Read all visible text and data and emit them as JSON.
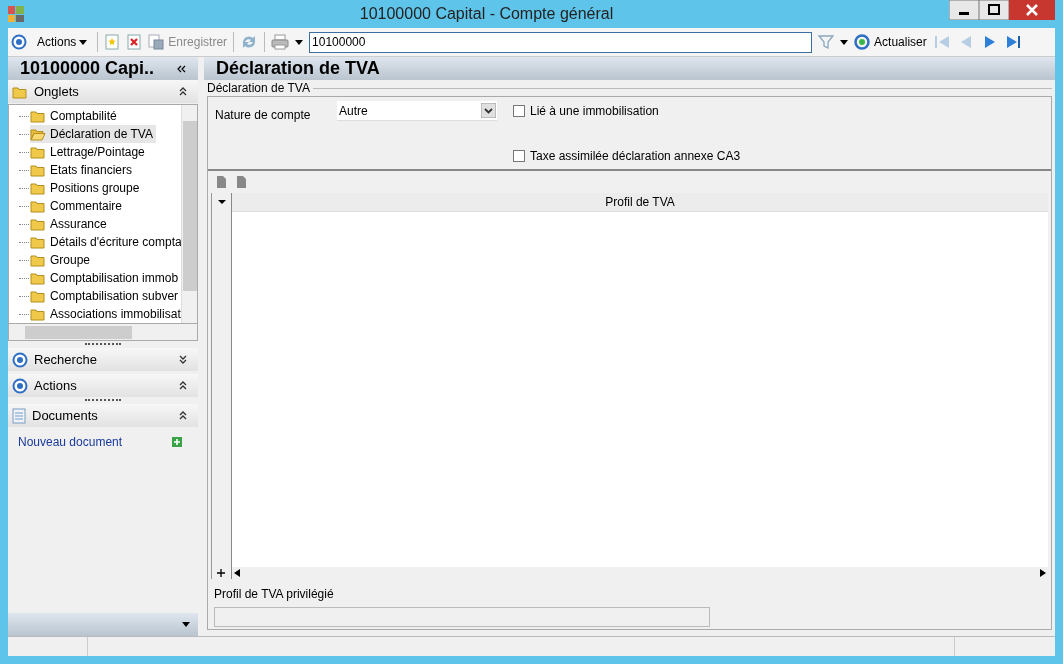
{
  "window": {
    "title": "10100000 Capital -  Compte général"
  },
  "toolbar": {
    "actions_label": "Actions",
    "save_label": "Enregistrer",
    "search_value": "10100000",
    "refresh_label": "Actualiser"
  },
  "left_panel": {
    "title": "10100000 Capi..",
    "sections": [
      {
        "kind": "tabs",
        "title": "Onglets",
        "expanded": true,
        "items": [
          {
            "label": "Comptabilité",
            "selected": false
          },
          {
            "label": "Déclaration de TVA",
            "selected": true
          },
          {
            "label": "Lettrage/Pointage",
            "selected": false
          },
          {
            "label": "Etats financiers",
            "selected": false
          },
          {
            "label": "Positions groupe",
            "selected": false
          },
          {
            "label": "Commentaire",
            "selected": false
          },
          {
            "label": "Assurance",
            "selected": false
          },
          {
            "label": "Détails d'écriture compta",
            "selected": false
          },
          {
            "label": "Groupe",
            "selected": false
          },
          {
            "label": "Comptabilisation immob",
            "selected": false
          },
          {
            "label": "Comptabilisation subver",
            "selected": false
          },
          {
            "label": "Associations immobilisat",
            "selected": false
          }
        ]
      },
      {
        "kind": "radio",
        "title": "Recherche",
        "expanded": false
      },
      {
        "kind": "radio",
        "title": "Actions",
        "expanded": true
      },
      {
        "kind": "documents",
        "title": "Documents",
        "expanded": true,
        "link": "Nouveau document"
      }
    ]
  },
  "main": {
    "title": "Déclaration de TVA",
    "group_title": "Déclaration de TVA",
    "nature_label": "Nature de compte",
    "nature_value": "Autre",
    "checkboxes": [
      {
        "label": "Lié à une immobilisation",
        "checked": false
      },
      {
        "label": "Taxe assimilée déclaration annexe CA3",
        "checked": false
      }
    ],
    "grid": {
      "columns": [
        "Profil de TVA"
      ]
    },
    "preferred_label": "Profil de TVA privilégié"
  }
}
